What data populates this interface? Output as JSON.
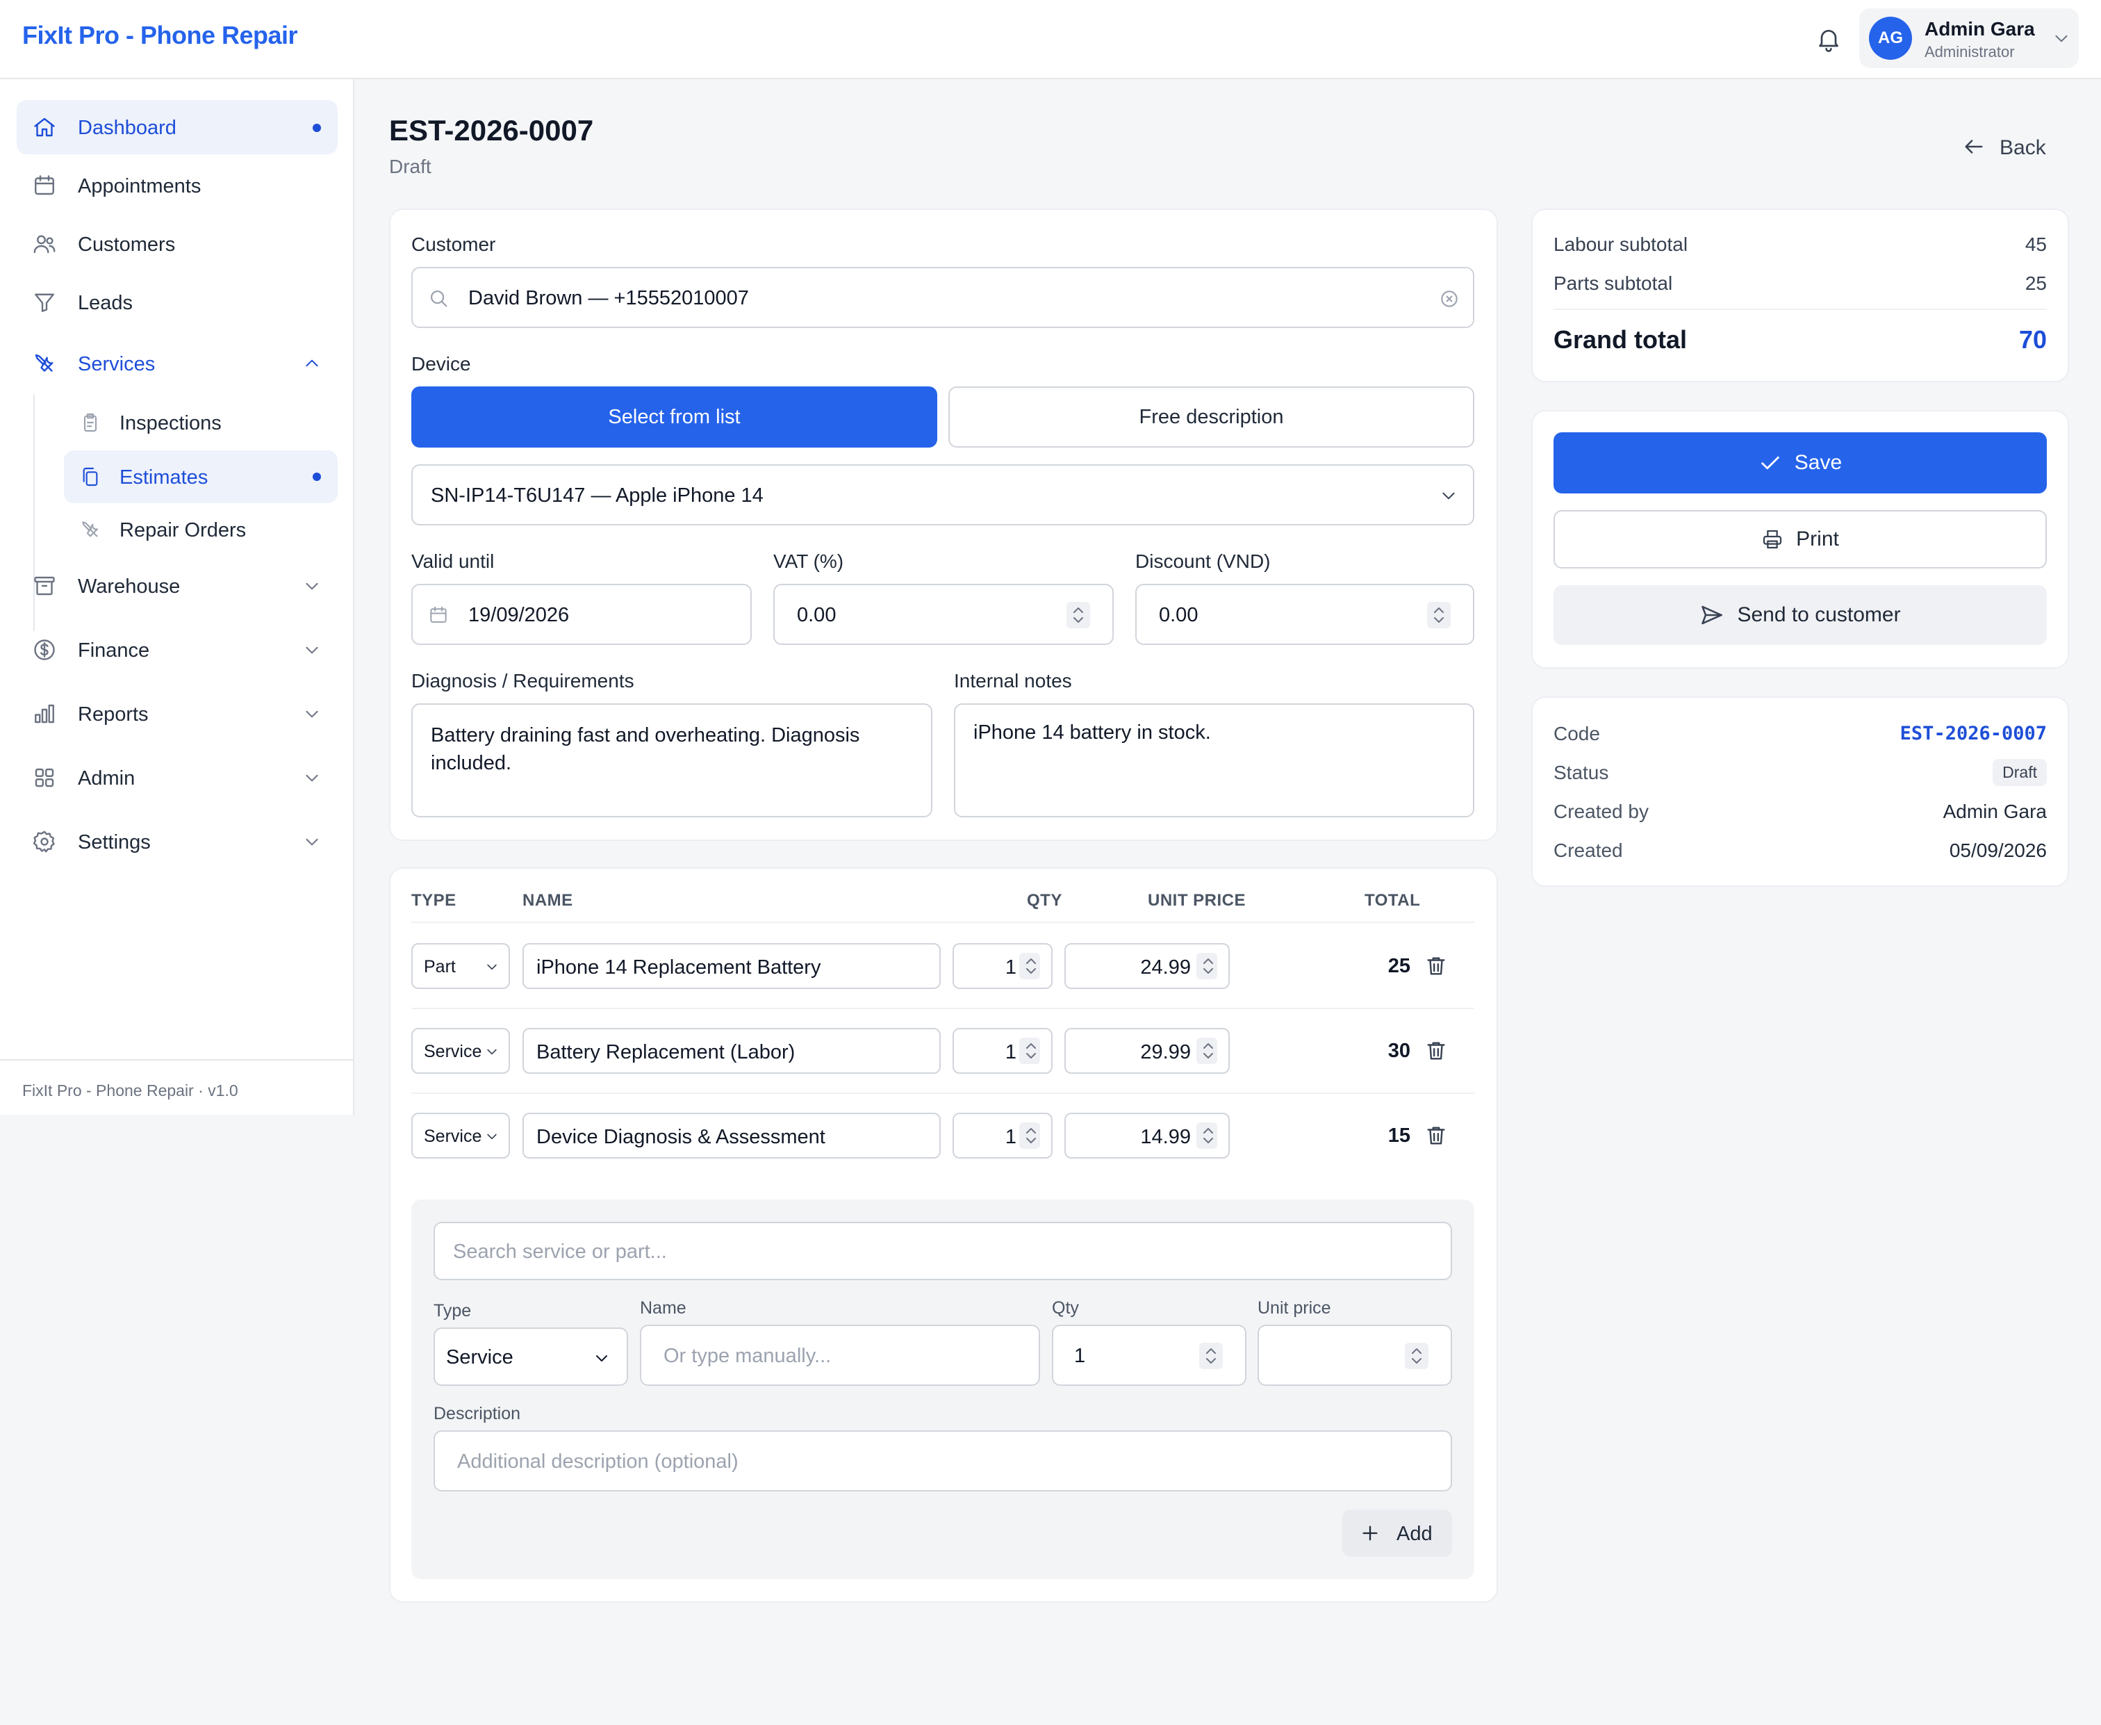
{
  "app": {
    "brand": "FixIt Pro - Phone Repair"
  },
  "user": {
    "initials": "AG",
    "name": "Admin Gara",
    "role": "Administrator"
  },
  "sidebar": {
    "items": [
      {
        "label": "Dashboard",
        "icon": "home-icon"
      },
      {
        "label": "Appointments",
        "icon": "calendar-icon"
      },
      {
        "label": "Customers",
        "icon": "users-icon"
      },
      {
        "label": "Leads",
        "icon": "funnel-icon"
      },
      {
        "label": "Services",
        "icon": "tools-icon"
      },
      {
        "label": "Warehouse",
        "icon": "archive-icon"
      },
      {
        "label": "Finance",
        "icon": "dollar-icon"
      },
      {
        "label": "Reports",
        "icon": "bar-chart-icon"
      },
      {
        "label": "Admin",
        "icon": "grid-icon"
      },
      {
        "label": "Settings",
        "icon": "gear-icon"
      }
    ],
    "subitems": [
      {
        "label": "Inspections"
      },
      {
        "label": "Estimates"
      },
      {
        "label": "Repair Orders"
      }
    ],
    "footer": "FixIt Pro - Phone Repair · v1.0"
  },
  "page": {
    "title": "EST-2026-0007",
    "status": "Draft",
    "back_label": "Back"
  },
  "form": {
    "customer_label": "Customer",
    "customer_value": "David Brown — +15552010007",
    "device_label": "Device",
    "device_mode_list": "Select from list",
    "device_mode_free": "Free description",
    "device_value": "SN-IP14-T6U147 — Apple iPhone 14",
    "valid_until_label": "Valid until",
    "valid_until_value": "19/09/2026",
    "vat_label": "VAT (%)",
    "vat_value": "0.00",
    "discount_label": "Discount (VND)",
    "discount_value": "0.00",
    "diagnosis_label": "Diagnosis / Requirements",
    "diagnosis_value": "Battery draining fast and overheating. Diagnosis included.",
    "notes_label": "Internal notes",
    "notes_value": "iPhone 14 battery in stock."
  },
  "table": {
    "headers": {
      "type": "TYPE",
      "name": "NAME",
      "qty": "QTY",
      "unit_price": "UNIT PRICE",
      "total": "TOTAL"
    },
    "rows": [
      {
        "type": "Part",
        "name": "iPhone 14 Replacement Battery",
        "qty": "1",
        "unit_price": "24.99",
        "total": "25"
      },
      {
        "type": "Service",
        "name": "Battery Replacement (Labor)",
        "qty": "1",
        "unit_price": "29.99",
        "total": "30"
      },
      {
        "type": "Service",
        "name": "Device Diagnosis & Assessment",
        "qty": "1",
        "unit_price": "14.99",
        "total": "15"
      }
    ]
  },
  "add_item": {
    "search_placeholder": "Search service or part...",
    "type_label": "Type",
    "type_value": "Service",
    "name_label": "Name",
    "name_placeholder": "Or type manually...",
    "qty_label": "Qty",
    "qty_value": "1",
    "unit_price_label": "Unit price",
    "description_label": "Description",
    "description_placeholder": "Additional description (optional)",
    "add_label": "Add"
  },
  "summary": {
    "labour_label": "Labour subtotal",
    "labour_value": "45",
    "parts_label": "Parts subtotal",
    "parts_value": "25",
    "grand_label": "Grand total",
    "grand_value": "70"
  },
  "actions": {
    "save": "Save",
    "print": "Print",
    "send": "Send to customer"
  },
  "meta": {
    "code_label": "Code",
    "code_value": "EST-2026-0007",
    "status_label": "Status",
    "status_value": "Draft",
    "created_by_label": "Created by",
    "created_by_value": "Admin Gara",
    "created_label": "Created",
    "created_value": "05/09/2026"
  },
  "colors": {
    "accent": "#2563eb",
    "accent_dark": "#1d4ed8",
    "background": "#f5f6f8"
  }
}
